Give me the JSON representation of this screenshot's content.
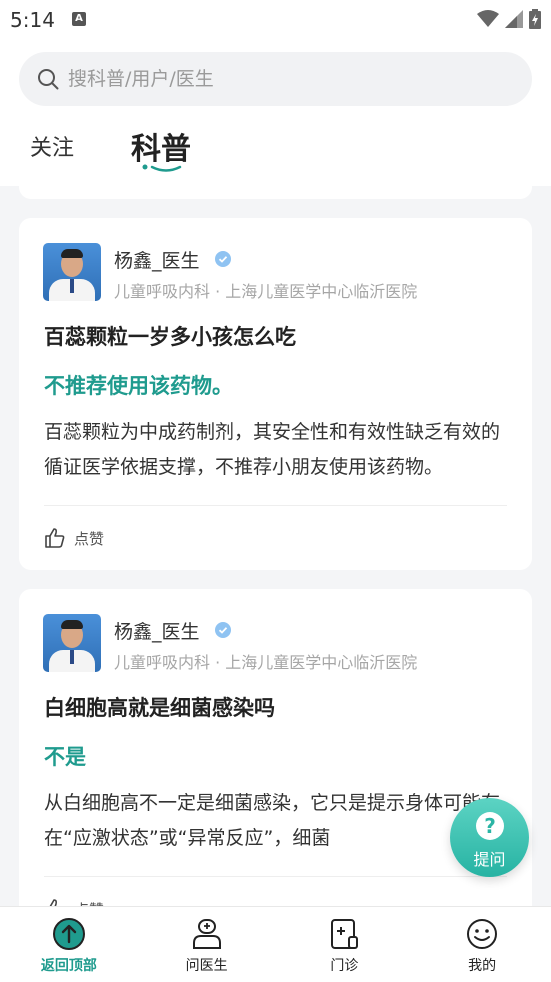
{
  "status_bar": {
    "time": "5:14"
  },
  "search": {
    "placeholder": "搜科普/用户/医生"
  },
  "tabs": [
    {
      "label": "关注",
      "active": false
    },
    {
      "label": "科普",
      "active": true
    }
  ],
  "colors": {
    "accent": "#1f9b8e",
    "background": "#f4f5f7"
  },
  "posts": [
    {
      "doctor_name": "杨鑫_医生",
      "department": "儿童呼吸内科 · 上海儿童医学中心临沂医院",
      "question": "百蕊颗粒一岁多小孩怎么吃",
      "answer_headline": "不推荐使用该药物。",
      "body": "百蕊颗粒为中成药制剂，其安全性和有效性缺乏有效的循证医学依据支撑，不推荐小朋友使用该药物。",
      "like_label": "点赞"
    },
    {
      "doctor_name": "杨鑫_医生",
      "department": "儿童呼吸内科 · 上海儿童医学中心临沂医院",
      "question": "白细胞高就是细菌感染吗",
      "answer_headline": "不是",
      "body": "从白细胞高不一定是细菌感染，它只是提示身体可能存在“应激状态”或“异常反应”，细菌",
      "like_label": "点赞"
    }
  ],
  "fab": {
    "label": "提问",
    "icon": "question-icon"
  },
  "bottom_nav": [
    {
      "label": "返回顶部",
      "icon": "arrow-up-circle-icon",
      "active": true
    },
    {
      "label": "问医生",
      "icon": "doctor-icon",
      "active": false
    },
    {
      "label": "门诊",
      "icon": "clinic-icon",
      "active": false
    },
    {
      "label": "我的",
      "icon": "smile-face-icon",
      "active": false
    }
  ]
}
